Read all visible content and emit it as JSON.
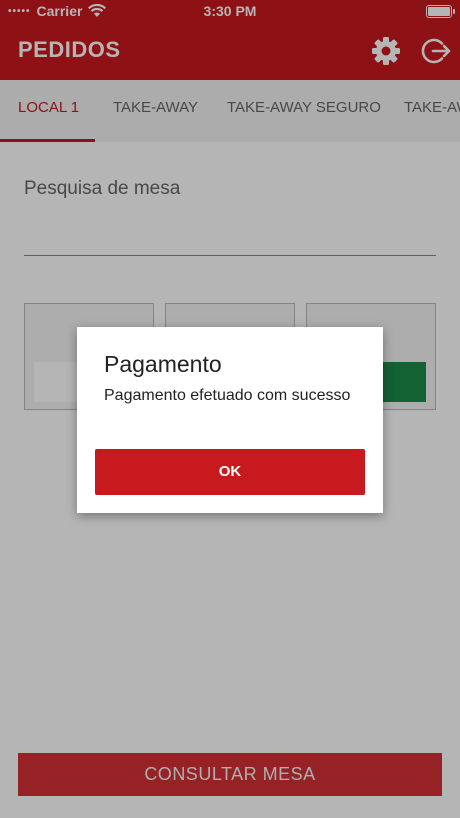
{
  "status_bar": {
    "carrier": "Carrier",
    "time": "3:30 PM",
    "signal_dots": "•••••"
  },
  "app_bar": {
    "title": "PEDIDOS",
    "settings_icon": "gear-icon",
    "logout_icon": "logout-icon"
  },
  "tabs": [
    {
      "label": "LOCAL 1",
      "active": true
    },
    {
      "label": "TAKE-AWAY",
      "active": false
    },
    {
      "label": "TAKE-AWAY SEGURO",
      "active": false
    },
    {
      "label": "TAKE-AW",
      "active": false
    }
  ],
  "search": {
    "label": "Pesquisa de mesa"
  },
  "bottom_button": {
    "label": "CONSULTAR MESA"
  },
  "dialog": {
    "title": "Pagamento",
    "message": "Pagamento efetuado com sucesso",
    "ok_label": "OK"
  },
  "colors": {
    "brand_red": "#c8191e",
    "table_green": "#1a8a4a",
    "overlay": "rgba(0,0,0,0.29)"
  }
}
